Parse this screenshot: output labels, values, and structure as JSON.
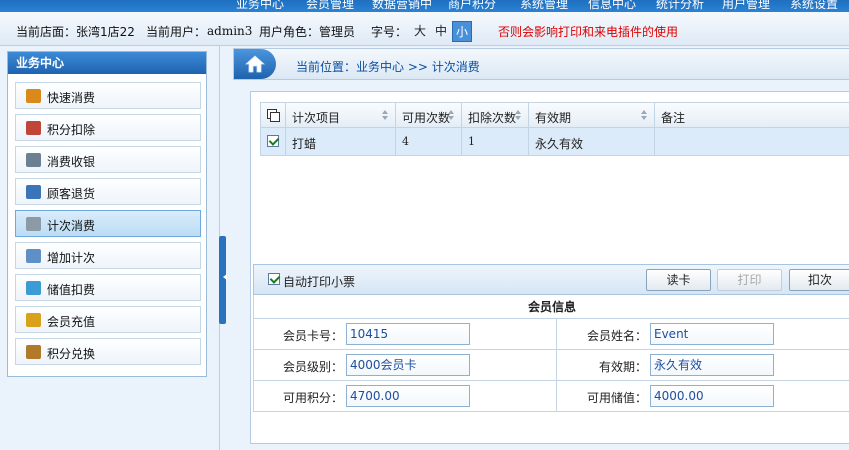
{
  "top_nav": {
    "items": [
      "业务中心",
      "会员管理",
      "数据营销中",
      "商户积分",
      "系统管理",
      "信息中心",
      "统计分析",
      "用户管理",
      "系统设置"
    ]
  },
  "info_bar": {
    "store_label": "当前店面：张湾1店22",
    "user_label": "当前用户：",
    "user_value": "admin3",
    "role_label": "用户角色：管理员",
    "font_label": "字号：",
    "font_sizes": [
      "大",
      "中",
      "小"
    ],
    "warning": "否则会影响打印和来电插件的使用"
  },
  "sidebar": {
    "title": "业务中心",
    "items": [
      {
        "label": "快速消费",
        "icon": "quick-consume-icon",
        "color": "#d98a1a"
      },
      {
        "label": "积分扣除",
        "icon": "points-deduct-icon",
        "color": "#c0463a"
      },
      {
        "label": "消费收银",
        "icon": "cashier-icon",
        "color": "#6d7f92"
      },
      {
        "label": "顾客退货",
        "icon": "return-goods-icon",
        "color": "#3b74b8"
      },
      {
        "label": "计次消费",
        "icon": "count-consume-icon",
        "color": "#8c9aa8"
      },
      {
        "label": "增加计次",
        "icon": "add-count-icon",
        "color": "#5e8fc6"
      },
      {
        "label": "储值扣费",
        "icon": "stored-value-icon",
        "color": "#3a9bd5"
      },
      {
        "label": "会员充值",
        "icon": "member-recharge-icon",
        "color": "#d9a21a"
      },
      {
        "label": "积分兑换",
        "icon": "points-exchange-icon",
        "color": "#b07a2a"
      }
    ],
    "active_index": 4
  },
  "breadcrumb": {
    "text": "当前位置：业务中心 >> 计次消费"
  },
  "grid": {
    "columns": [
      "计次项目",
      "可用次数",
      "扣除次数",
      "有效期",
      "备注"
    ],
    "rows": [
      {
        "checked": true,
        "item": "打蜡",
        "available": "4",
        "deduct": "1",
        "validity": "永久有效",
        "remark": ""
      }
    ]
  },
  "toolbar": {
    "auto_print_label": "自动打印小票",
    "auto_print_checked": true,
    "read_card": "读卡",
    "print": "打印",
    "deduct": "扣次"
  },
  "member_info": {
    "title": "会员信息",
    "card_no_label": "会员卡号：",
    "card_no": "10415",
    "name_label": "会员姓名：",
    "name": "Event",
    "level_label": "会员级别：",
    "level": "4000会员卡",
    "expiry_label": "有效期：",
    "expiry": "永久有效",
    "points_label": "可用积分：",
    "points": "4700.00",
    "balance_label": "可用储值：",
    "balance": "4000.00"
  },
  "colors": {
    "accent": "#2b82d4",
    "warning": "#dd0000",
    "selected_row": "#dcebf9"
  }
}
